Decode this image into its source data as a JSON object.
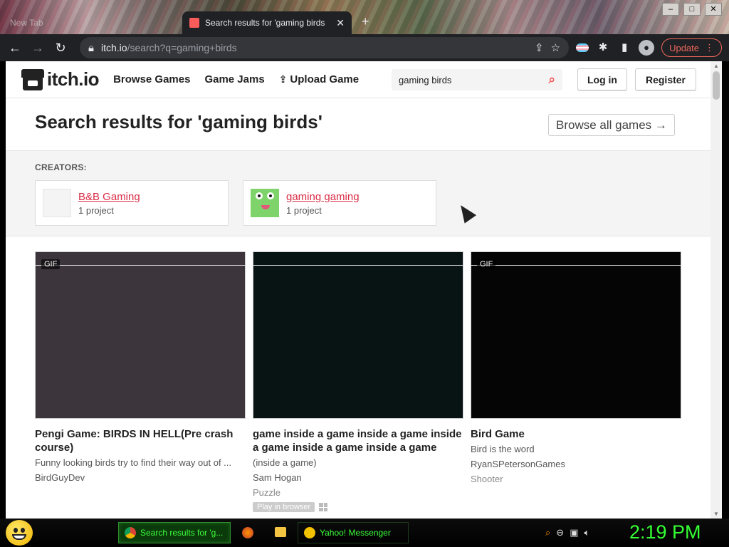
{
  "browser": {
    "inactive_tab_label": "New Tab",
    "active_tab_label": "Search results for 'gaming birds",
    "new_tab_glyph": "+",
    "url_host": "itch.io",
    "url_path": "/search?q=gaming+birds",
    "update_label": "Update",
    "window_controls": [
      "–",
      "□",
      "✕"
    ]
  },
  "site": {
    "logo_text": "itch.io",
    "nav": {
      "browse_games": "Browse Games",
      "game_jams": "Game Jams",
      "upload_game": "Upload Game"
    },
    "search_value": "gaming birds",
    "login_label": "Log in",
    "register_label": "Register"
  },
  "results": {
    "title": "Search results for 'gaming birds'",
    "browse_all_label": "Browse all games →"
  },
  "creators": {
    "label": "CREATORS:",
    "items": [
      {
        "name": "B&B Gaming",
        "count": "1 project"
      },
      {
        "name": "gaming gaming",
        "count": "1 project"
      }
    ]
  },
  "games": [
    {
      "badge": "GIF",
      "thumb_color": "#3d353c",
      "title": "Pengi Game: BIRDS IN HELL(Pre crash course)",
      "desc": "Funny looking birds try to find their way out of ...",
      "author": "BirdGuyDev"
    },
    {
      "badge": "",
      "thumb_color": "#081313",
      "title": "game inside a game inside a game inside a game inside a game inside a game",
      "desc": "(inside a game)",
      "author": "Sam Hogan",
      "genre": "Puzzle",
      "platform_badge": "Play in browser"
    },
    {
      "badge": "GIF",
      "thumb_color": "#050505",
      "title": "Bird Game",
      "desc": "Bird is the word",
      "author": "RyanSPetersonGames",
      "genre": "Shooter"
    }
  ],
  "taskbar": {
    "active_task": "Search results for 'g...",
    "yahoo_task": "Yahoo! Messenger",
    "clock": "2:19 PM"
  }
}
